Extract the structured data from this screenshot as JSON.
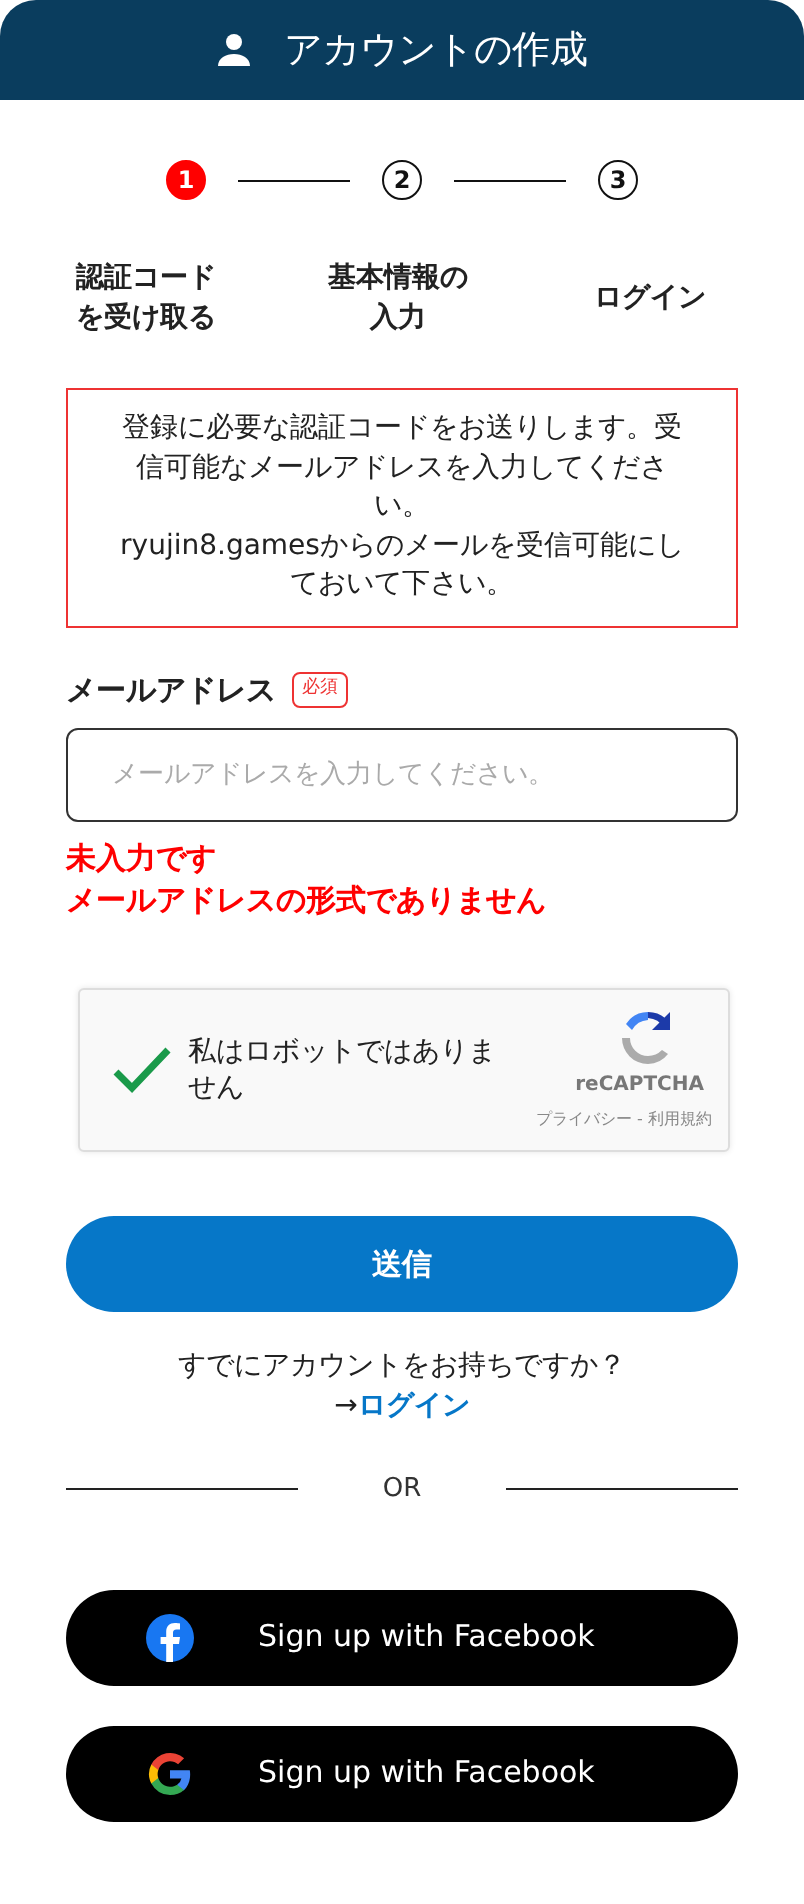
{
  "header": {
    "title": "アカウントの作成"
  },
  "steps": [
    {
      "number": "1",
      "label": "認証コードを受け取る",
      "selected": true
    },
    {
      "number": "2",
      "label": "基本情報の入力",
      "selected": false
    },
    {
      "number": "3",
      "label": "ログイン",
      "selected": false
    }
  ],
  "notice": "登録に必要な認証コードをお送りします。受信可能なメールアドレスを入力してください。\nryujin8.gamesからのメールを受信可能にしておいて下さい。",
  "email": {
    "label": "メールアドレス",
    "required_badge": "必須",
    "placeholder": "メールアドレスを入力してください。",
    "errors": [
      "未入力です",
      "メールアドレスの形式でありません"
    ]
  },
  "captcha": {
    "checked": true,
    "label": "私はロボットではありません",
    "brand": "reCAPTCHA",
    "links": "プライバシー - 利用規約"
  },
  "submit": "送信",
  "login_prompt": {
    "question": "すでにアカウントをお持ちですか？",
    "arrow": "→",
    "link": "ログイン"
  },
  "divider": "OR",
  "social_buttons": [
    {
      "kind": "facebook",
      "label": "Sign up with Facebook"
    },
    {
      "kind": "google",
      "label": "Sign up with Facebook"
    }
  ]
}
